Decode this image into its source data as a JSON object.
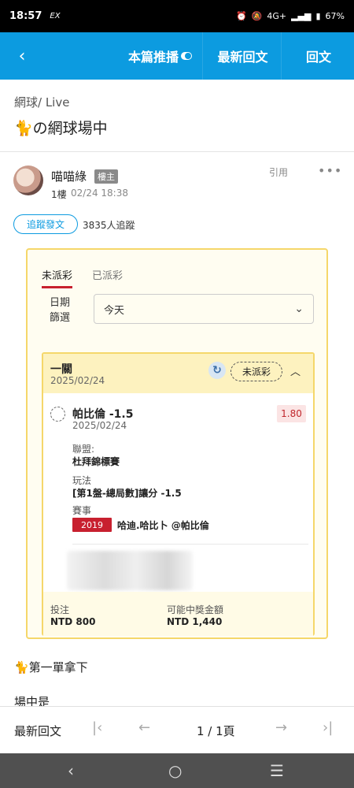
{
  "status_bar": {
    "time": "18:57",
    "carrier_icon": "EX",
    "network": "4G+",
    "battery": "67%"
  },
  "nav": {
    "back_icon": "back-icon",
    "tab_recommend": "本篇推播",
    "tab_latest": "最新回文",
    "tab_reply": "回文"
  },
  "breadcrumb": "網球/ Live",
  "title": "🐈の網球場中",
  "post": {
    "author": "喵喵綠",
    "badge": "樓主",
    "floor": "1樓",
    "time": "02/24 18:38",
    "quote": "引用",
    "more": "•••",
    "follow_button": "追蹤發文",
    "followers": "3835人追蹤"
  },
  "bet_card": {
    "tab_unsettled": "未派彩",
    "tab_settled": "已派彩",
    "date_label_1": "日期",
    "date_label_2": "篩選",
    "date_value": "今天",
    "parlay_title": "一關",
    "parlay_date": "2025/02/24",
    "status": "未派彩",
    "pick": {
      "title": "帕比倫 -1.5",
      "date": "2025/02/24",
      "odds": "1.80",
      "league_label": "聯盟:",
      "league_value": "杜拜錦標賽",
      "market_label": "玩法",
      "market_value": "[第1盤-總局數]讓分 -1.5",
      "match_label": "賽事",
      "match_tag": "2019",
      "match_teams": "哈迪.哈比卜 @帕比倫"
    },
    "stake_label": "投注",
    "stake_value": "NTD 800",
    "payout_label": "可能中獎金額",
    "payout_value": "NTD 1,440"
  },
  "content": {
    "line1": "🐈第一單拿下",
    "line2": "場中是"
  },
  "bottom_bar": {
    "label": "最新回文",
    "page": "1 / 1頁"
  }
}
